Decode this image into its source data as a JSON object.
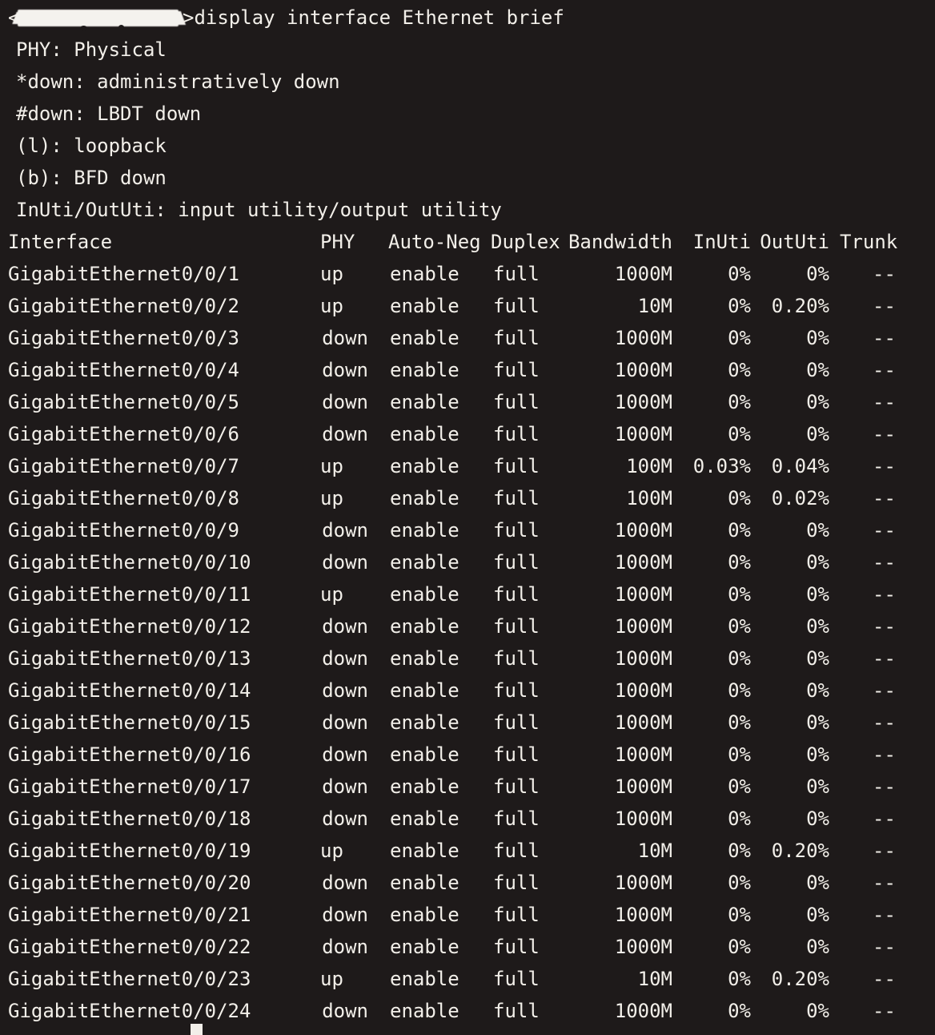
{
  "terminal": {
    "background_color": "#1e1a1a",
    "text_color": "#f2efe9",
    "prompt": {
      "open_bracket": "<",
      "hostname_redacted": true,
      "close_bracket": ">",
      "command": "display interface Ethernet brief"
    },
    "cursor": {
      "visible": true,
      "color": "#f2efe9"
    }
  },
  "legend": {
    "lines": [
      "PHY: Physical",
      "*down: administratively down",
      "#down: LBDT down",
      "(l): loopback",
      "(b): BFD down",
      "InUti/OutUti: input utility/output utility"
    ]
  },
  "table": {
    "headers": {
      "interface": "Interface",
      "phy": "PHY",
      "auto_neg": "Auto-Neg",
      "duplex": "Duplex",
      "bandwidth": "Bandwidth",
      "in_uti": "InUti",
      "out_uti": "OutUti",
      "trunk": "Trunk"
    },
    "rows": [
      {
        "interface": "GigabitEthernet0/0/1",
        "phy": "up",
        "auto_neg": "enable",
        "duplex": "full",
        "bandwidth": "1000M",
        "in_uti": "0%",
        "out_uti": "0%",
        "trunk": "--"
      },
      {
        "interface": "GigabitEthernet0/0/2",
        "phy": "up",
        "auto_neg": "enable",
        "duplex": "full",
        "bandwidth": "10M",
        "in_uti": "0%",
        "out_uti": "0.20%",
        "trunk": "--"
      },
      {
        "interface": "GigabitEthernet0/0/3",
        "phy": "down",
        "auto_neg": "enable",
        "duplex": "full",
        "bandwidth": "1000M",
        "in_uti": "0%",
        "out_uti": "0%",
        "trunk": "--"
      },
      {
        "interface": "GigabitEthernet0/0/4",
        "phy": "down",
        "auto_neg": "enable",
        "duplex": "full",
        "bandwidth": "1000M",
        "in_uti": "0%",
        "out_uti": "0%",
        "trunk": "--"
      },
      {
        "interface": "GigabitEthernet0/0/5",
        "phy": "down",
        "auto_neg": "enable",
        "duplex": "full",
        "bandwidth": "1000M",
        "in_uti": "0%",
        "out_uti": "0%",
        "trunk": "--"
      },
      {
        "interface": "GigabitEthernet0/0/6",
        "phy": "down",
        "auto_neg": "enable",
        "duplex": "full",
        "bandwidth": "1000M",
        "in_uti": "0%",
        "out_uti": "0%",
        "trunk": "--"
      },
      {
        "interface": "GigabitEthernet0/0/7",
        "phy": "up",
        "auto_neg": "enable",
        "duplex": "full",
        "bandwidth": "100M",
        "in_uti": "0.03%",
        "out_uti": "0.04%",
        "trunk": "--"
      },
      {
        "interface": "GigabitEthernet0/0/8",
        "phy": "up",
        "auto_neg": "enable",
        "duplex": "full",
        "bandwidth": "100M",
        "in_uti": "0%",
        "out_uti": "0.02%",
        "trunk": "--"
      },
      {
        "interface": "GigabitEthernet0/0/9",
        "phy": "down",
        "auto_neg": "enable",
        "duplex": "full",
        "bandwidth": "1000M",
        "in_uti": "0%",
        "out_uti": "0%",
        "trunk": "--"
      },
      {
        "interface": "GigabitEthernet0/0/10",
        "phy": "down",
        "auto_neg": "enable",
        "duplex": "full",
        "bandwidth": "1000M",
        "in_uti": "0%",
        "out_uti": "0%",
        "trunk": "--"
      },
      {
        "interface": "GigabitEthernet0/0/11",
        "phy": "up",
        "auto_neg": "enable",
        "duplex": "full",
        "bandwidth": "1000M",
        "in_uti": "0%",
        "out_uti": "0%",
        "trunk": "--"
      },
      {
        "interface": "GigabitEthernet0/0/12",
        "phy": "down",
        "auto_neg": "enable",
        "duplex": "full",
        "bandwidth": "1000M",
        "in_uti": "0%",
        "out_uti": "0%",
        "trunk": "--"
      },
      {
        "interface": "GigabitEthernet0/0/13",
        "phy": "down",
        "auto_neg": "enable",
        "duplex": "full",
        "bandwidth": "1000M",
        "in_uti": "0%",
        "out_uti": "0%",
        "trunk": "--"
      },
      {
        "interface": "GigabitEthernet0/0/14",
        "phy": "down",
        "auto_neg": "enable",
        "duplex": "full",
        "bandwidth": "1000M",
        "in_uti": "0%",
        "out_uti": "0%",
        "trunk": "--"
      },
      {
        "interface": "GigabitEthernet0/0/15",
        "phy": "down",
        "auto_neg": "enable",
        "duplex": "full",
        "bandwidth": "1000M",
        "in_uti": "0%",
        "out_uti": "0%",
        "trunk": "--"
      },
      {
        "interface": "GigabitEthernet0/0/16",
        "phy": "down",
        "auto_neg": "enable",
        "duplex": "full",
        "bandwidth": "1000M",
        "in_uti": "0%",
        "out_uti": "0%",
        "trunk": "--"
      },
      {
        "interface": "GigabitEthernet0/0/17",
        "phy": "down",
        "auto_neg": "enable",
        "duplex": "full",
        "bandwidth": "1000M",
        "in_uti": "0%",
        "out_uti": "0%",
        "trunk": "--"
      },
      {
        "interface": "GigabitEthernet0/0/18",
        "phy": "down",
        "auto_neg": "enable",
        "duplex": "full",
        "bandwidth": "1000M",
        "in_uti": "0%",
        "out_uti": "0%",
        "trunk": "--"
      },
      {
        "interface": "GigabitEthernet0/0/19",
        "phy": "up",
        "auto_neg": "enable",
        "duplex": "full",
        "bandwidth": "10M",
        "in_uti": "0%",
        "out_uti": "0.20%",
        "trunk": "--"
      },
      {
        "interface": "GigabitEthernet0/0/20",
        "phy": "down",
        "auto_neg": "enable",
        "duplex": "full",
        "bandwidth": "1000M",
        "in_uti": "0%",
        "out_uti": "0%",
        "trunk": "--"
      },
      {
        "interface": "GigabitEthernet0/0/21",
        "phy": "down",
        "auto_neg": "enable",
        "duplex": "full",
        "bandwidth": "1000M",
        "in_uti": "0%",
        "out_uti": "0%",
        "trunk": "--"
      },
      {
        "interface": "GigabitEthernet0/0/22",
        "phy": "down",
        "auto_neg": "enable",
        "duplex": "full",
        "bandwidth": "1000M",
        "in_uti": "0%",
        "out_uti": "0%",
        "trunk": "--"
      },
      {
        "interface": "GigabitEthernet0/0/23",
        "phy": "up",
        "auto_neg": "enable",
        "duplex": "full",
        "bandwidth": "10M",
        "in_uti": "0%",
        "out_uti": "0.20%",
        "trunk": "--"
      },
      {
        "interface": "GigabitEthernet0/0/24",
        "phy": "down",
        "auto_neg": "enable",
        "duplex": "full",
        "bandwidth": "1000M",
        "in_uti": "0%",
        "out_uti": "0%",
        "trunk": "--"
      }
    ]
  }
}
